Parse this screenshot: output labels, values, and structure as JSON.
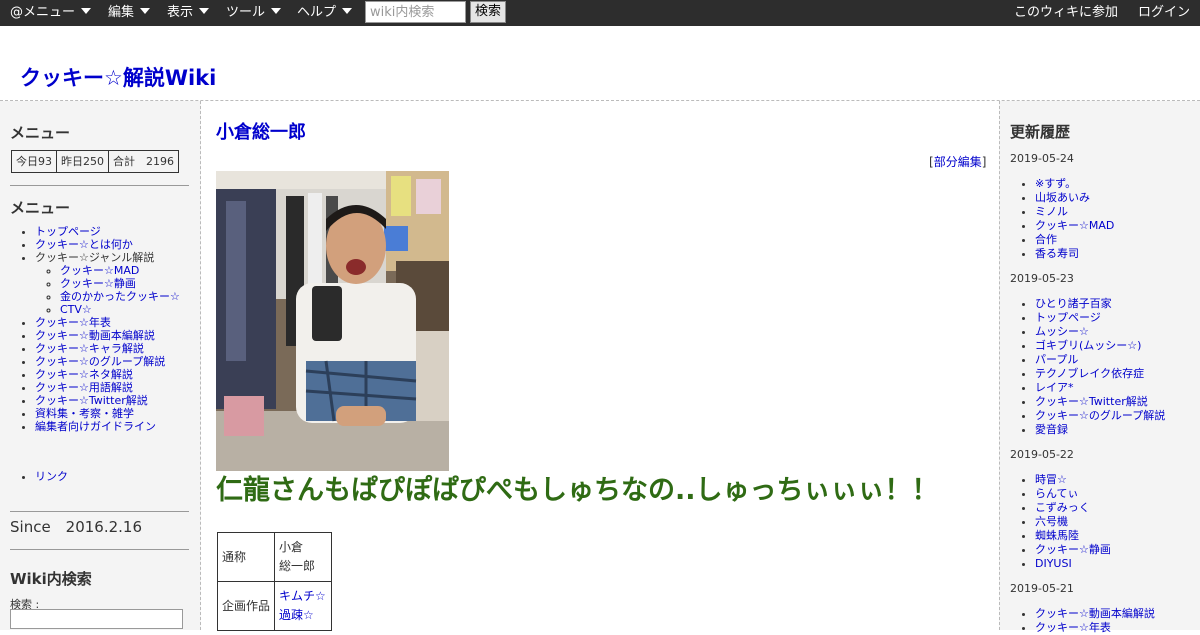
{
  "topbar": {
    "menus": [
      "@メニュー",
      "編集",
      "表示",
      "ツール",
      "ヘルプ"
    ],
    "search_placeholder": "wiki内検索",
    "search_button": "検索",
    "join": "このウィキに参加",
    "login": "ログイン"
  },
  "site": {
    "title": "クッキー☆解説Wiki"
  },
  "left": {
    "menu_heading": "メニュー",
    "counter": {
      "today": "今日93",
      "yesterday": "昨日250",
      "total": "合計　2196"
    },
    "menu_heading2": "メニュー",
    "menu": [
      "トップページ",
      "クッキー☆とは何か",
      "クッキー☆ジャンル解説",
      "クッキー☆MAD",
      "クッキー☆静画",
      "金のかかったクッキー☆",
      "CTV☆",
      "クッキー☆年表",
      "クッキー☆動画本編解説",
      "クッキー☆キャラ解説",
      "クッキー☆のグループ解説",
      "クッキー☆ネタ解説",
      "クッキー☆用語解説",
      "クッキー☆Twitter解説",
      "資料集・考察・雑学",
      "編集者向けガイドライン"
    ],
    "link": "リンク",
    "since": "Since　2016.2.16",
    "search_heading": "Wiki内検索",
    "search_label": "検索 :"
  },
  "main": {
    "title": "小倉総一郎",
    "edit_open": "[",
    "edit": "部分編集",
    "edit_close": "]",
    "headline": "仁龍さんもぱぴぽぱぴぺもしゅちなの..しゅっちぃぃぃ！！",
    "table": {
      "label1": "通称",
      "value1_a": "小倉",
      "value1_b": "総一郎",
      "label2": "企画作品",
      "value2_a": "キムチ☆",
      "value2_b": "過疎☆"
    }
  },
  "right": {
    "title": "更新履歴",
    "groups": [
      {
        "date": "2019-05-24",
        "items": [
          "※すず。",
          "山坂あいみ",
          "ミノル",
          "クッキー☆MAD",
          "合作",
          "香る寿司"
        ]
      },
      {
        "date": "2019-05-23",
        "items": [
          "ひとり諸子百家",
          "トップページ",
          "ムッシー☆",
          "ゴキブリ(ムッシー☆)",
          "パープル",
          "テクノブレイク依存症",
          "レイア*",
          "クッキー☆Twitter解説",
          "クッキー☆のグループ解説",
          "愛音録"
        ]
      },
      {
        "date": "2019-05-22",
        "items": [
          "時冒☆",
          "らんてぃ",
          "こずみっく",
          "六号機",
          "蜘蛛馬陸",
          "クッキー☆静画",
          "DIYUSI"
        ]
      },
      {
        "date": "2019-05-21",
        "items": [
          "クッキー☆動画本編解説",
          "クッキー☆年表"
        ]
      }
    ]
  }
}
